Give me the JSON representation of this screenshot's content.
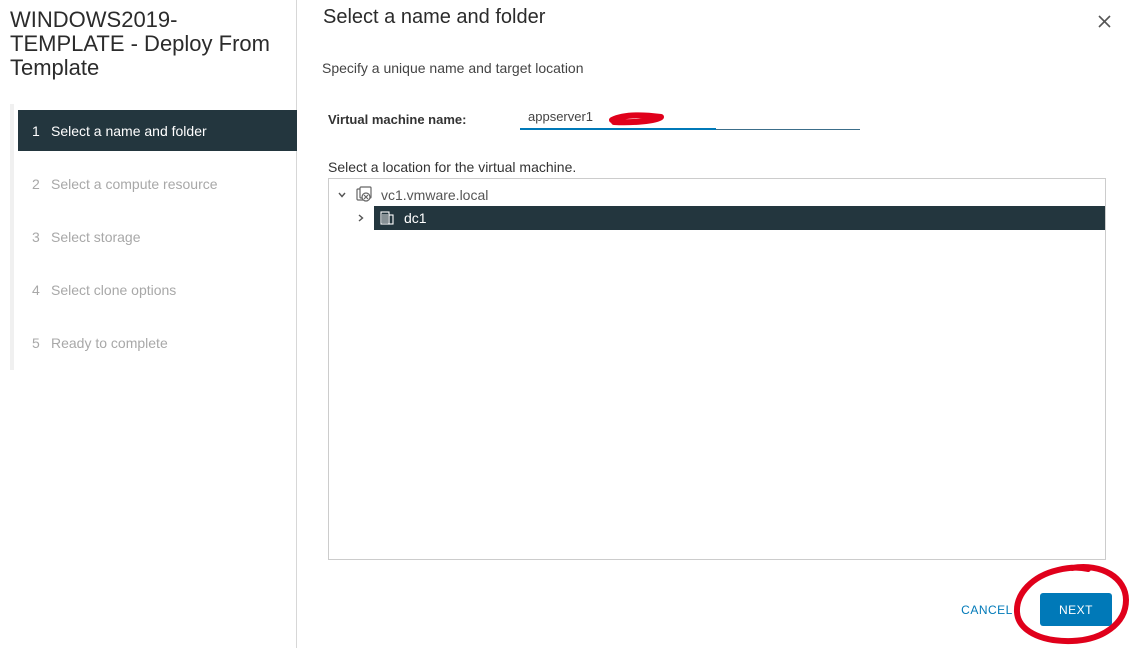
{
  "wizard": {
    "title": "WINDOWS2019-TEMPLATE - Deploy From Template",
    "steps": [
      {
        "num": "1",
        "label": "Select a name and folder",
        "active": true
      },
      {
        "num": "2",
        "label": "Select a compute resource",
        "active": false
      },
      {
        "num": "3",
        "label": "Select storage",
        "active": false
      },
      {
        "num": "4",
        "label": "Select clone options",
        "active": false
      },
      {
        "num": "5",
        "label": "Ready to complete",
        "active": false
      }
    ]
  },
  "main": {
    "title": "Select a name and folder",
    "subtitle": "Specify a unique name and target location",
    "vm_name_label": "Virtual machine name:",
    "vm_name_value": "appserver1",
    "location_label": "Select a location for the virtual machine.",
    "tree": {
      "root": {
        "label": "vc1.vmware.local",
        "icon": "vcenter-icon",
        "expanded": true
      },
      "child": {
        "label": "dc1",
        "icon": "datacenter-icon",
        "selected": true,
        "expanded": false
      }
    }
  },
  "footer": {
    "cancel_label": "CANCEL",
    "next_label": "NEXT"
  },
  "colors": {
    "accent": "#0079b8",
    "selected_bg": "#23363e",
    "annotation": "#e0001b"
  }
}
